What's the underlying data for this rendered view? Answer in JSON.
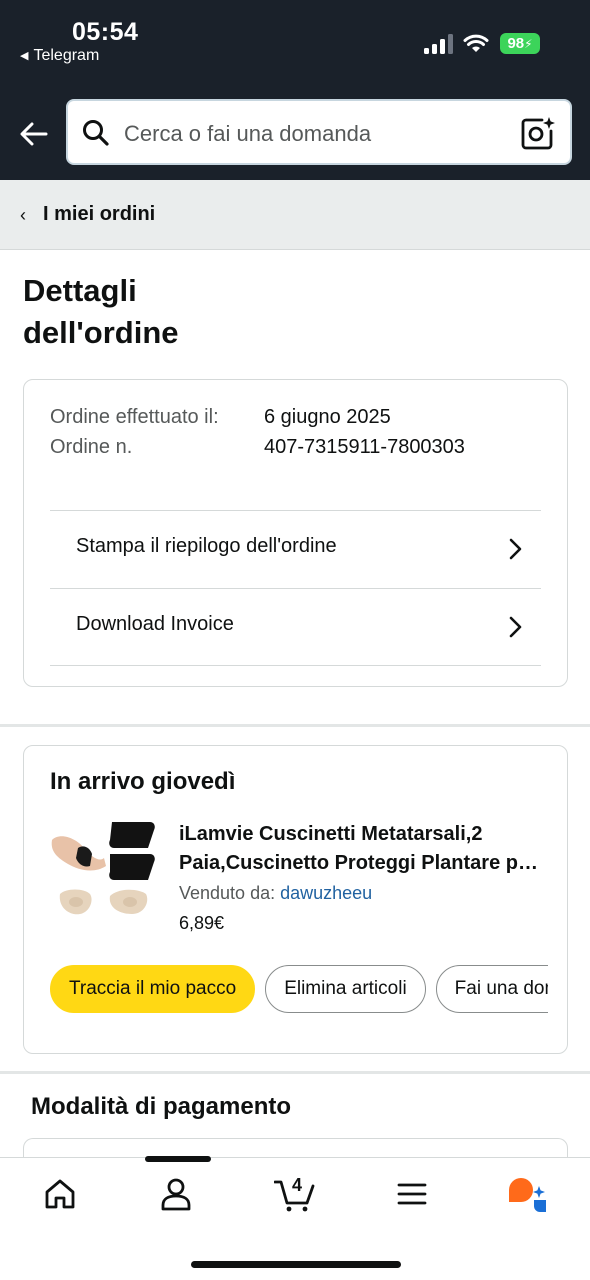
{
  "status_bar": {
    "time": "05:54",
    "back_app": "Telegram",
    "battery": "98"
  },
  "search": {
    "placeholder": "Cerca o fai una domanda"
  },
  "breadcrumb": {
    "label": "I miei ordini"
  },
  "page": {
    "title": "Dettagli dell'ordine"
  },
  "order": {
    "placed_label": "Ordine effettuato il:",
    "placed_value": "6 giugno 2025",
    "number_label": "Ordine n.",
    "number_value": "407-7315911-7800303",
    "actions": [
      {
        "label": "Stampa il riepilogo dell'ordine"
      },
      {
        "label": "Download Invoice"
      }
    ]
  },
  "shipment": {
    "status": "In arrivo giovedì",
    "product_title": "iLamvie Cuscinetti Metatarsali,2 Paia,Cuscinetto Proteggi Plantare per Dolore Piedi",
    "seller_label": "Venduto da:",
    "seller_name": "dawuzheeu",
    "price": "6,89€",
    "buttons": [
      {
        "label": "Traccia il mio pacco"
      },
      {
        "label": "Elimina articoli"
      },
      {
        "label": "Fai una domanda"
      }
    ]
  },
  "payment": {
    "title": "Modalità di pagamento"
  },
  "tabbar": {
    "cart_count": "4"
  },
  "colors": {
    "header": "#1a212a",
    "primary_button": "#ffd814",
    "link": "#2162a1",
    "battery": "#3cd45a"
  }
}
